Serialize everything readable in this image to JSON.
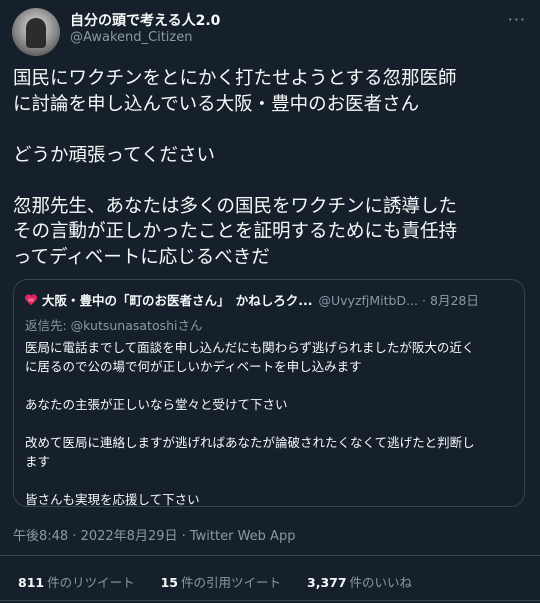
{
  "author": {
    "display_name": "自分の頭で考える人2.0",
    "handle": "@Awakend_Citizen",
    "avatar_icon": "avatar-thinker-statue"
  },
  "more_icon": "···",
  "tweet": {
    "text": "国民にワクチンをとにかく打たせようとする忽那医師\nに討論を申し込んでいる大阪・豊中のお医者さん\n\nどうか頑張ってください\n\n忽那先生、あなたは多くの国民をワクチンに誘導した\nその言動が正しかったことを証明するためにも責任持\nってディベートに応じるべきだ"
  },
  "quote": {
    "display_name": "大阪・豊中の「町のお医者さん」　かねしろク...",
    "handle": "@UvyzfjMitbD...",
    "date": "8月28日",
    "reply_to": "返信先: @kutsunasatoshiさん",
    "body": "医局に電話までして面談を申し込んだにも関わらず逃げられましたが阪大の近く\nに居るので公の場で何が正しいかディベートを申し込みます\n\nあなたの主張が正しいなら堂々と受けて下さい\n\n改めて医局に連絡しますが逃げればあなたが論破されたくなくて逃げたと判断し\nます\n\n皆さんも実現を応援して下さい",
    "badge_color": "#e0245e"
  },
  "meta": "午後8:48 · 2022年8月29日 · Twitter Web App",
  "stats": {
    "retweets_count": "811",
    "retweets_label": "件のリツイート",
    "quotes_count": "15",
    "quotes_label": "件の引用ツイート",
    "likes_count": "3,377",
    "likes_label": "件のいいね"
  }
}
